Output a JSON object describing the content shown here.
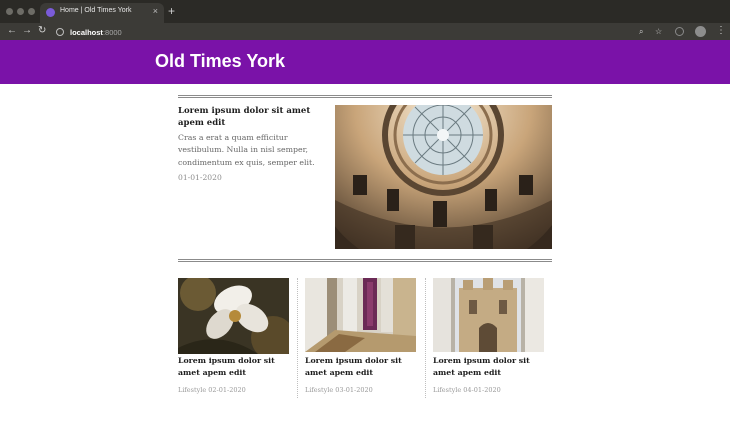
{
  "browser": {
    "tab_title": "Home | Old Times York",
    "tab_close": "×",
    "new_tab": "+",
    "url_host": "localhost",
    "url_port": ":8000",
    "back": "←",
    "forward": "→",
    "reload": "↻",
    "zoom_icon": "⌕",
    "star_icon": "☆",
    "menu_icon": "⋮"
  },
  "site": {
    "title": "Old Times York"
  },
  "featured": {
    "title": "Lorem ipsum dolor sit amet apem edit",
    "excerpt": "Cras a erat a quam efficitur vestibulum. Nulla in nisl semper, condimentum ex quis, semper elit.",
    "date": "01-01-2020"
  },
  "cards": [
    {
      "title": "Lorem ipsum dolor sit amet apem edit",
      "meta": "Lifestyle 02-01-2020"
    },
    {
      "title": "Lorem ipsum dolor sit amet apem edit",
      "meta": "Lifestyle 03-01-2020"
    },
    {
      "title": "Lorem ipsum dolor sit amet apem edit",
      "meta": "Lifestyle 04-01-2020"
    }
  ],
  "colors": {
    "header": "#7a12a8",
    "chrome": "#2b2a26",
    "toolbar": "#3c3b37"
  }
}
